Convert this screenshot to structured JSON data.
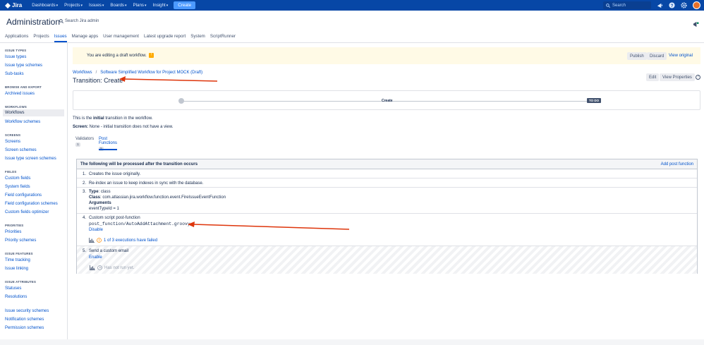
{
  "topbar": {
    "brand": "Jira",
    "nav": [
      "Dashboards",
      "Projects",
      "Issues",
      "Boards",
      "Plans",
      "Insight"
    ],
    "create": "Create",
    "search_placeholder": "Search"
  },
  "header": {
    "title": "Administration",
    "search_label": "Search Jira admin"
  },
  "tabs": [
    {
      "label": "Applications",
      "active": false
    },
    {
      "label": "Projects",
      "active": false
    },
    {
      "label": "Issues",
      "active": true
    },
    {
      "label": "Manage apps",
      "active": false
    },
    {
      "label": "User management",
      "active": false
    },
    {
      "label": "Latest upgrade report",
      "active": false
    },
    {
      "label": "System",
      "active": false
    },
    {
      "label": "ScriptRunner",
      "active": false
    }
  ],
  "sidebar": {
    "sections": [
      {
        "title": "ISSUE TYPES",
        "items": [
          "Issue types",
          "Issue type schemes",
          "Sub-tasks"
        ]
      },
      {
        "title": "BROWSE AND EXPORT",
        "items": [
          "Archived issues"
        ]
      },
      {
        "title": "WORKFLOWS",
        "items": [
          "Workflows",
          "Workflow schemes"
        ]
      },
      {
        "title": "SCREENS",
        "items": [
          "Screens",
          "Screen schemes",
          "Issue type screen schemes"
        ]
      },
      {
        "title": "FIELDS",
        "items": [
          "Custom fields",
          "System fields",
          "Field configurations",
          "Field configuration schemes",
          "Custom fields optimizer"
        ]
      },
      {
        "title": "PRIORITIES",
        "items": [
          "Priorities",
          "Priority schemes"
        ]
      },
      {
        "title": "ISSUE FEATURES",
        "items": [
          "Time tracking",
          "Issue linking"
        ]
      },
      {
        "title": "ISSUE ATTRIBUTES",
        "items": [
          "Statuses",
          "Resolutions"
        ]
      },
      {
        "title": "",
        "items": [
          "Issue security schemes",
          "Notification schemes",
          "Permission schemes"
        ]
      }
    ],
    "selected": "Workflows"
  },
  "banner": {
    "text": "You are editing a draft workflow.",
    "publish": "Publish",
    "discard": "Discard",
    "view_original": "View original"
  },
  "breadcrumb": {
    "root": "Workflows",
    "sep": "/",
    "current": "Software Simplified Workflow for Project MOCK (Draft)"
  },
  "page": {
    "title": "Transition: Create",
    "edit": "Edit",
    "view_properties": "View Properties"
  },
  "diagram": {
    "transition": "Create",
    "status": "TO DO"
  },
  "info": {
    "line1_pre": "This is the ",
    "line1_bold": "initial",
    "line1_post": " transition in the workflow.",
    "line2_label": "Screen:",
    "line2_value": " None - initial transition does not have a view."
  },
  "subtabs": [
    {
      "label": "Validators",
      "count": "1",
      "active": false
    },
    {
      "label": "Post Functions",
      "count": "5",
      "active": true
    }
  ],
  "post_functions": {
    "header": "The following will be processed after the transition occurs",
    "add": "Add post function",
    "items": [
      {
        "num": "1.",
        "text": "Creates the issue originally."
      },
      {
        "num": "2.",
        "text": "Re-index an issue to keep indexes in sync with the database."
      },
      {
        "num": "3.",
        "type_label": "Type",
        "type_value": ": class",
        "class_label": "Class",
        "class_value": ": com.atlassian.jira.workflow.function.event.FireIssueEventFunction",
        "args_label": "Arguments",
        "args_value": "eventTypeId = 1"
      },
      {
        "num": "4.",
        "title": "Custom script post-function",
        "script": "post_function/AutoAddAttachment.groovy",
        "action": "Disable",
        "status": "1 of 3 executions have failed"
      },
      {
        "num": "5.",
        "title": "Send a custom email",
        "action": "Enable",
        "status": "Has not run yet."
      }
    ]
  },
  "colors": {
    "topbar": "#0747a6",
    "link": "#0052cc",
    "banner": "#fffae6",
    "arrow": "#de350b"
  }
}
